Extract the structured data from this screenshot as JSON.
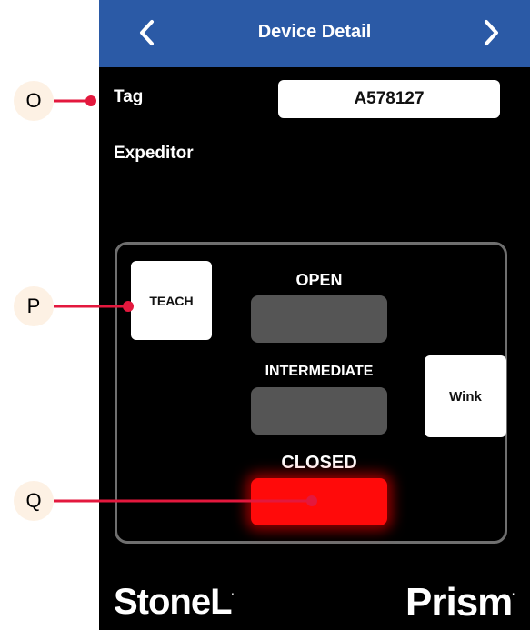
{
  "header": {
    "title": "Device Detail",
    "prev_icon": "chevron-left-icon",
    "next_icon": "chevron-right-icon"
  },
  "fields": {
    "tag_label": "Tag",
    "tag_value": "A578127",
    "expeditor_label": "Expeditor"
  },
  "controls": {
    "teach_label": "TEACH",
    "wink_label": "Wink"
  },
  "states": {
    "open_label": "OPEN",
    "intermediate_label": "INTERMEDIATE",
    "closed_label": "CLOSED",
    "active_state": "CLOSED",
    "active_color": "#ff0a0a",
    "inactive_color": "#555555"
  },
  "branding": {
    "left_logo": "StoneL",
    "right_logo": "Prism",
    "trademark": "."
  },
  "callouts": [
    {
      "letter": "O"
    },
    {
      "letter": "P"
    },
    {
      "letter": "Q"
    }
  ],
  "colors": {
    "header_bg": "#2b5aa6",
    "callout_line": "#e3183d",
    "callout_circle": "#fdf1e4"
  }
}
